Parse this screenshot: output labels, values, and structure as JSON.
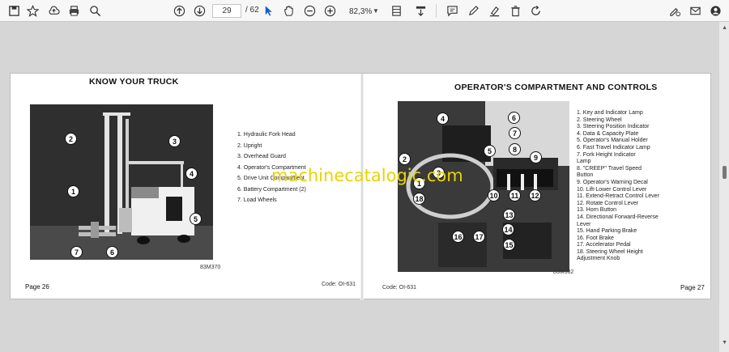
{
  "toolbar": {
    "current_page": "29",
    "page_separator": "/ 62",
    "zoom": "82,3%",
    "icons": [
      "save-icon",
      "bookmark-star-icon",
      "upload-icon",
      "print-icon",
      "zoom-search-icon",
      "page-up-icon",
      "page-down-icon",
      "select-cursor-icon",
      "hand-icon",
      "zoom-out-icon",
      "zoom-in-icon",
      "fit-page-icon",
      "scroll-mode-icon",
      "comment-icon",
      "pen-icon",
      "highlight-icon",
      "delete-icon",
      "rotate-icon",
      "sign-icon",
      "email-icon",
      "account-icon"
    ]
  },
  "left_page": {
    "title": "KNOW YOUR TRUCK",
    "legend": [
      "1.  Hydraulic Fork Head",
      "2.  Upright",
      "3.  Overhead Guard",
      "4.  Operator's Compartment",
      "5.  Drive Unit Compartment",
      "6.  Battery Compartment (2)",
      "7.  Load Wheels"
    ],
    "callouts": [
      "1",
      "2",
      "3",
      "4",
      "5",
      "6",
      "7"
    ],
    "photo_code": "83M370",
    "page_label": "Page 26",
    "code": "Code: OI-631"
  },
  "right_page": {
    "title": "OPERATOR'S COMPARTMENT AND CONTROLS",
    "legend": [
      "1.  Key and Indicator Lamp",
      "2.  Steering Wheel",
      "3.  Steering Position Indicator",
      "4.  Data & Capacity Plate",
      "5.  Operator's Manual Holder",
      "6.  Fast Travel Indicator Lamp",
      "7.  Fork Height Indicator",
      "     Lamp",
      "8.  \"CREEP\" Travel Speed",
      "     Button",
      "9.  Operator's Warning Decal",
      "10.  Lift-Lower Control Lever",
      "11.  Extend-Retract Control Lever",
      "12.  Rotate Control Lever",
      "13.  Horn Button",
      "14.  Directional Forward-Reverse",
      "      Lever",
      "15.  Hand Parking Brake",
      "16.  Foot Brake",
      "17.  Accelerator Pedal",
      "18.  Steering Wheel Height",
      "      Adjustment Knob"
    ],
    "callouts": [
      "1",
      "2",
      "3",
      "4",
      "5",
      "6",
      "7",
      "8",
      "9",
      "10",
      "11",
      "12",
      "13",
      "14",
      "15",
      "16",
      "17",
      "18"
    ],
    "photo_code": "83M302",
    "page_label": "Page 27",
    "code": "Code: OI-631"
  },
  "watermark": "machinecatalogic.com"
}
